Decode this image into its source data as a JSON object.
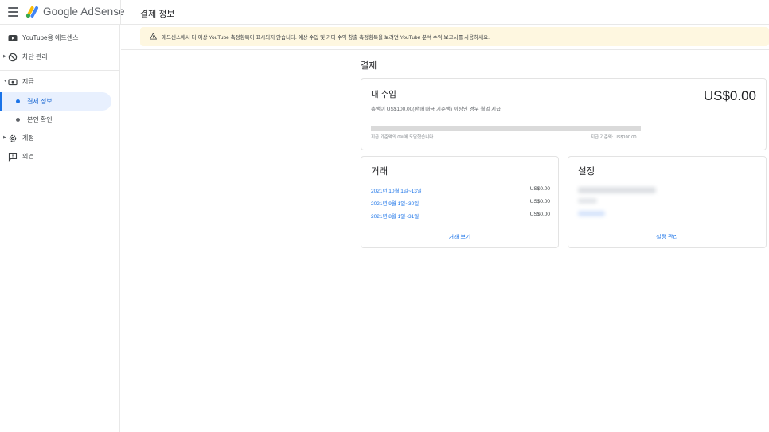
{
  "header": {
    "app_name": "Google AdSense",
    "page_title": "결제 정보"
  },
  "sidebar": {
    "items": [
      {
        "label": "YouTube용 애드센스",
        "icon": "youtube-icon"
      },
      {
        "label": "차단 관리",
        "icon": "block-icon"
      },
      {
        "label": "지급",
        "icon": "payments-icon"
      },
      {
        "label": "계정",
        "icon": "gear-icon"
      },
      {
        "label": "의견",
        "icon": "feedback-icon"
      }
    ],
    "payment_sub": [
      {
        "label": "결제 정보",
        "active": true
      },
      {
        "label": "본인 확인",
        "active": false
      }
    ]
  },
  "banner": {
    "text": "애드센스에서 더 이상 YouTube 측정항목이 표시되지 않습니다. 예상 수입 및 기타 수익 창출 측정항목을 보려면 YouTube 분석 수익 보고서를 사용하세요."
  },
  "main": {
    "section_title": "결제",
    "earnings": {
      "title": "내 수입",
      "description": "총액이 US$100.00(판매 대금 기준액) 이상인 경우 월별 지급",
      "amount": "US$0.00",
      "progress_fraction": 0,
      "progress_left": "지급 기준액의 0%에 도달했습니다.",
      "progress_right": "지급 기준액: US$100.00"
    },
    "transactions": {
      "title": "거래",
      "rows": [
        {
          "period": "2021년 10월 1일~13일",
          "amount": "US$0.00"
        },
        {
          "period": "2021년 9월 1일~30일",
          "amount": "US$0.00"
        },
        {
          "period": "2021년 8월 1일~31일",
          "amount": "US$0.00"
        }
      ],
      "link": "거래 보기"
    },
    "settings": {
      "title": "설정",
      "link": "설정 관리"
    }
  },
  "colors": {
    "accent": "#1a73e8",
    "banner_bg": "#fef7e0",
    "active_nav_bg": "#e8f0fe"
  }
}
